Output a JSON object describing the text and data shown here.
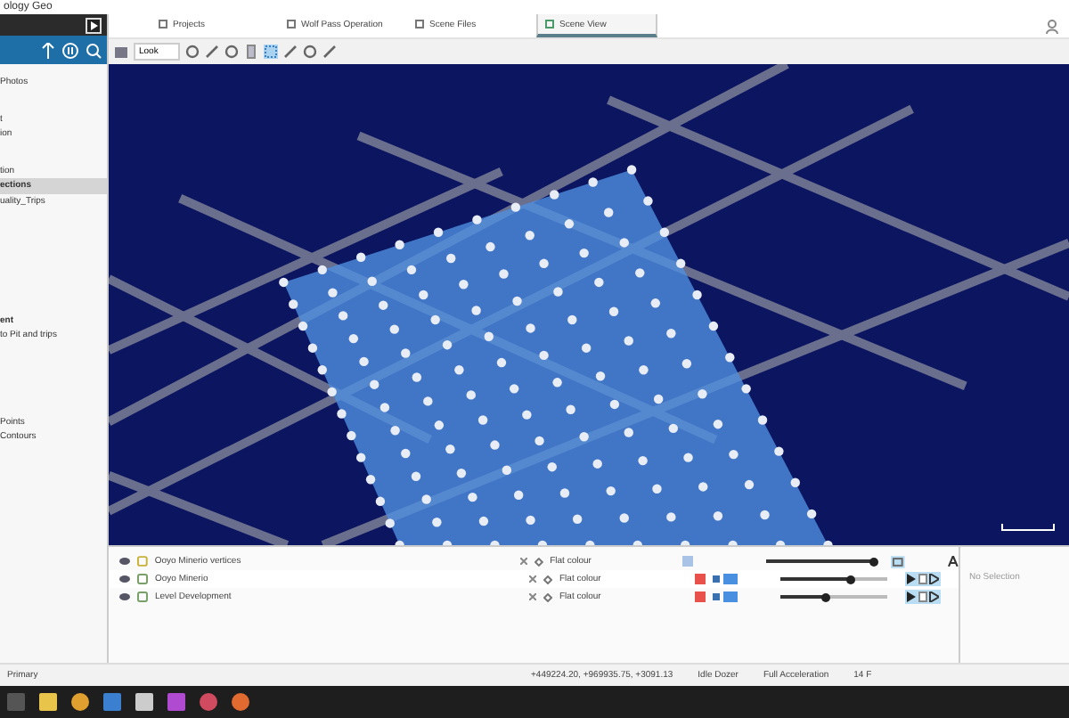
{
  "window": {
    "title": "ology Geo"
  },
  "sidebar": {
    "items": [
      {
        "label": "Photos",
        "selected": false,
        "bold": false
      },
      {
        "label": "t",
        "selected": false,
        "bold": false
      },
      {
        "label": "ion",
        "selected": false,
        "bold": false
      },
      {
        "label": "tion",
        "selected": false,
        "bold": false
      },
      {
        "label": "ections",
        "selected": true,
        "bold": true
      },
      {
        "label": "uality_Trips",
        "selected": false,
        "bold": false
      },
      {
        "label": "ent",
        "selected": false,
        "bold": true
      },
      {
        "label": "to Pit and trips",
        "selected": false,
        "bold": false
      },
      {
        "label": "Points",
        "selected": false,
        "bold": false
      },
      {
        "label": "Contours",
        "selected": false,
        "bold": false
      }
    ]
  },
  "tabs": [
    {
      "label": "Projects",
      "selected": false
    },
    {
      "label": "Wolf Pass Operation",
      "selected": false
    },
    {
      "label": "Scene Files",
      "selected": false
    },
    {
      "label": "Scene View",
      "selected": true
    }
  ],
  "toolbar": {
    "look": "Look"
  },
  "scene_rows": [
    {
      "kind": "surface",
      "name": "Ooyo Minerio vertices",
      "style": "Flat colour",
      "color": "#a9c3e6",
      "level": 1.0
    },
    {
      "kind": "mesh",
      "name": "Ooyo Minerio",
      "style": "Flat colour",
      "color": "#e8524a",
      "level": 0.65
    },
    {
      "kind": "mesh",
      "name": "Level Development",
      "style": "Flat colour",
      "color": "#e8524a",
      "level": 0.43
    }
  ],
  "properties": {
    "empty_text": "No Selection"
  },
  "status_bar": {
    "left": "Primary",
    "coordinates": "+449224.20, +969935.75, +3091.13",
    "mode": "Idle Dozer",
    "acceleration": "Full Acceleration",
    "fps": "14 F"
  }
}
